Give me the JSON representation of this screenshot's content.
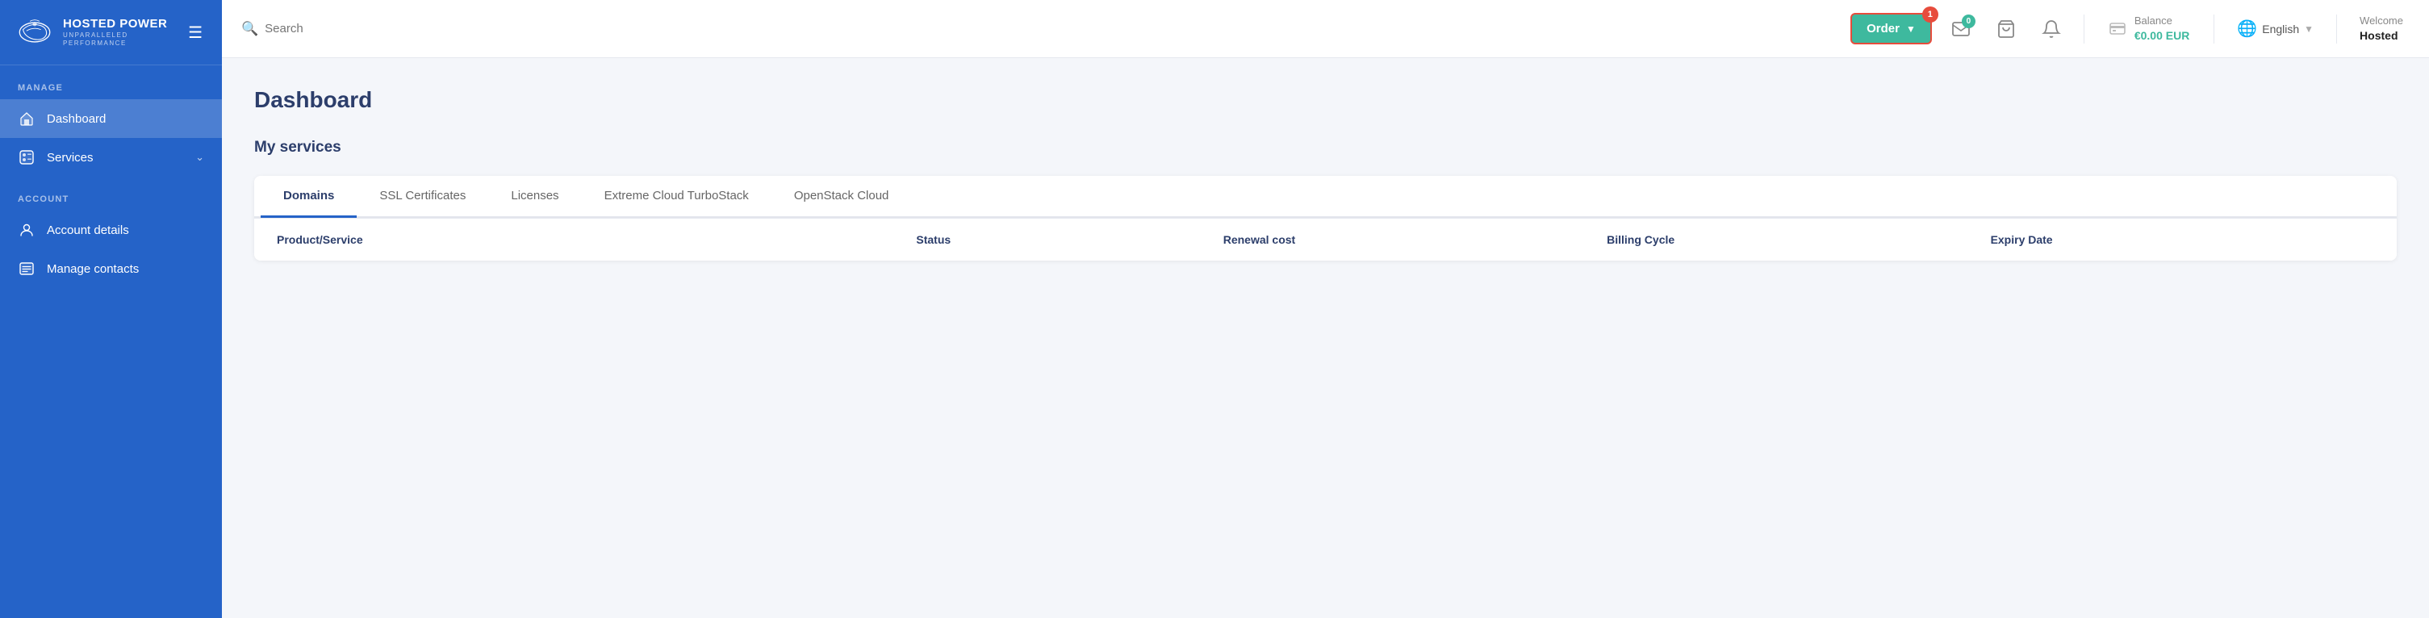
{
  "sidebar": {
    "logo": {
      "main": "HOSTED POWER",
      "sub": "UNPARALLELED PERFORMANCE"
    },
    "sections": [
      {
        "label": "MANAGE",
        "items": [
          {
            "id": "dashboard",
            "label": "Dashboard",
            "icon": "🏠",
            "active": true
          },
          {
            "id": "services",
            "label": "Services",
            "icon": "👤",
            "active": false,
            "hasChevron": true
          }
        ]
      },
      {
        "label": "ACCOUNT",
        "items": [
          {
            "id": "account-details",
            "label": "Account details",
            "icon": "👤",
            "active": false
          },
          {
            "id": "manage-contacts",
            "label": "Manage contacts",
            "icon": "📋",
            "active": false
          }
        ]
      }
    ]
  },
  "topbar": {
    "search_placeholder": "Search",
    "order_btn_label": "Order",
    "order_badge": "1",
    "messages_badge": "0",
    "balance_label": "Balance",
    "balance_value": "€0.00 EUR",
    "language": "English",
    "welcome_label": "Welcome",
    "welcome_name": "Hosted"
  },
  "content": {
    "page_title": "Dashboard",
    "section_title": "My services",
    "tabs": [
      {
        "id": "domains",
        "label": "Domains",
        "active": true
      },
      {
        "id": "ssl",
        "label": "SSL Certificates",
        "active": false
      },
      {
        "id": "licenses",
        "label": "Licenses",
        "active": false
      },
      {
        "id": "extreme-cloud",
        "label": "Extreme Cloud TurboStack",
        "active": false
      },
      {
        "id": "openstack",
        "label": "OpenStack Cloud",
        "active": false
      }
    ],
    "table_columns": [
      {
        "id": "product",
        "label": "Product/Service"
      },
      {
        "id": "status",
        "label": "Status"
      },
      {
        "id": "renewal",
        "label": "Renewal cost"
      },
      {
        "id": "billing",
        "label": "Billing Cycle"
      },
      {
        "id": "expiry",
        "label": "Expiry Date"
      }
    ]
  }
}
